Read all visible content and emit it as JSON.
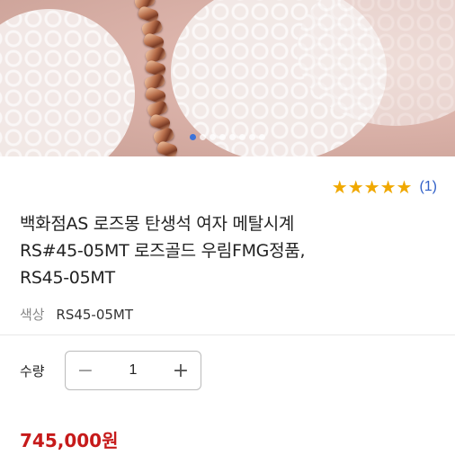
{
  "product_image": {
    "carousel_dot_count": 8,
    "active_dot_index": 0
  },
  "rating": {
    "stars": 5,
    "count_text": "(1)"
  },
  "product": {
    "title_lines": [
      "백화점AS 로즈몽 탄생석 여자 메탈시계",
      "RS#45-05MT 로즈골드 우림FMG정품,",
      "RS45-05MT"
    ],
    "option_label": "색상",
    "option_value": "RS45-05MT"
  },
  "quantity": {
    "label": "수량",
    "value": "1",
    "minus_symbol": "−",
    "plus_symbol": "+"
  },
  "price": {
    "text": "745,000원"
  },
  "colors": {
    "accent_blue": "#3d73d9",
    "price_red": "#c61a1a",
    "star_gold": "#f0a800"
  }
}
